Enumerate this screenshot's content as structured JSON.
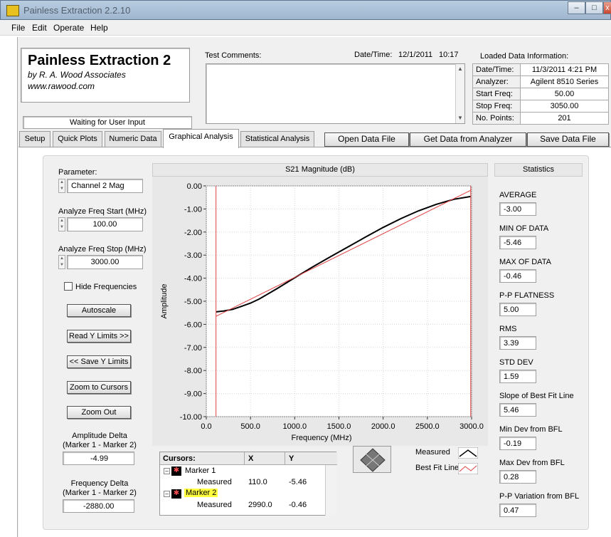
{
  "window": {
    "title": "Painless Extraction 2.2.10"
  },
  "menu": [
    "File",
    "Edit",
    "Operate",
    "Help"
  ],
  "brand": {
    "title": "Painless Extraction 2",
    "company": "by R. A. Wood Associates",
    "url": "www.rawood.com"
  },
  "status": "Waiting for User Input",
  "comments": {
    "label": "Test Comments:",
    "value": ""
  },
  "datetime": {
    "label": "Date/Time:",
    "date": "12/1/2011",
    "time": "10:17"
  },
  "loaded": {
    "title": "Loaded Data Information:",
    "rows": [
      {
        "label": "Date/Time:",
        "value": "11/3/2011 4:21 PM"
      },
      {
        "label": "Analyzer:",
        "value": "Agilent 8510 Series"
      },
      {
        "label": "Start Freq:",
        "value": "50.00"
      },
      {
        "label": "Stop Freq:",
        "value": "3050.00"
      },
      {
        "label": "No. Points:",
        "value": "201"
      }
    ]
  },
  "tabs": [
    "Setup",
    "Quick Plots",
    "Numeric Data",
    "Graphical Analysis",
    "Statistical Analysis"
  ],
  "actions": {
    "open": "Open Data File",
    "get": "Get Data from Analyzer",
    "save": "Save Data File"
  },
  "controls": {
    "parameter_label": "Parameter:",
    "parameter_value": "Channel 2 Mag",
    "start_label": "Analyze Freq Start (MHz)",
    "start_value": "100.00",
    "stop_label": "Analyze Freq Stop (MHz)",
    "stop_value": "3000.00",
    "hide_label": "Hide Frequencies",
    "autoscale": "Autoscale",
    "read_y": "Read Y Limits >>",
    "save_y": "<< Save Y Limits",
    "zoom_cursors": "Zoom to Cursors",
    "zoom_out": "Zoom Out",
    "amp_delta_label1": "Amplitude Delta",
    "amp_delta_label2": "(Marker 1 - Marker 2)",
    "amp_delta_value": "-4.99",
    "freq_delta_label1": "Frequency Delta",
    "freq_delta_label2": "(Marker 1 - Marker 2)",
    "freq_delta_value": "-2880.00"
  },
  "cursors": {
    "header": "Cursors:",
    "x": "X",
    "y": "Y",
    "items": [
      {
        "name": "Marker 1",
        "sub": "Measured",
        "x": "110.0",
        "y": "-5.46"
      },
      {
        "name": "Marker 2",
        "sub": "Measured",
        "x": "2990.0",
        "y": "-0.46"
      }
    ]
  },
  "legend": {
    "measured": "Measured",
    "bestfit": "Best Fit Line"
  },
  "stats": {
    "title": "Statistics",
    "items": [
      {
        "label": "AVERAGE",
        "value": "-3.00"
      },
      {
        "label": "MIN OF DATA",
        "value": "-5.46"
      },
      {
        "label": "MAX OF DATA",
        "value": "-0.46"
      },
      {
        "label": "P-P FLATNESS",
        "value": "5.00"
      },
      {
        "label": "RMS",
        "value": "3.39"
      },
      {
        "label": "STD DEV",
        "value": "1.59"
      },
      {
        "label": "Slope of Best Fit Line",
        "value": "5.46"
      },
      {
        "label": "Min Dev from BFL",
        "value": "-0.19"
      },
      {
        "label": "Max Dev from BFL",
        "value": "0.28"
      },
      {
        "label": "P-P Variation from BFL",
        "value": "0.47"
      }
    ]
  },
  "colors": {
    "measured": "#000000",
    "bestfit": "#e04040",
    "cursor": "#e04040",
    "marker_highlight": "#ffff40"
  },
  "chart_data": {
    "type": "line",
    "title": "S21 Magnitude (dB)",
    "xlabel": "Frequency (MHz)",
    "ylabel": "Amplitude",
    "xlim": [
      0,
      3000
    ],
    "ylim": [
      -10,
      0
    ],
    "xticks": [
      "0.0",
      "500.0",
      "1000.0",
      "1500.0",
      "2000.0",
      "2500.0",
      "3000.0"
    ],
    "yticks": [
      "0.00",
      "-1.00",
      "-2.00",
      "-3.00",
      "-4.00",
      "-5.00",
      "-6.00",
      "-7.00",
      "-8.00",
      "-9.00",
      "-10.00"
    ],
    "series": [
      {
        "name": "Measured",
        "x": [
          110,
          200,
          300,
          400,
          500,
          600,
          800,
          1000,
          1200,
          1400,
          1600,
          1800,
          2000,
          2200,
          2400,
          2600,
          2800,
          2990
        ],
        "y": [
          -5.46,
          -5.42,
          -5.35,
          -5.22,
          -5.08,
          -4.9,
          -4.45,
          -3.98,
          -3.52,
          -3.08,
          -2.65,
          -2.22,
          -1.8,
          -1.42,
          -1.08,
          -0.8,
          -0.58,
          -0.46
        ]
      },
      {
        "name": "Best Fit Line",
        "x": [
          110,
          2990
        ],
        "y": [
          -5.65,
          -0.19
        ]
      }
    ],
    "cursors": [
      110,
      2990
    ]
  }
}
